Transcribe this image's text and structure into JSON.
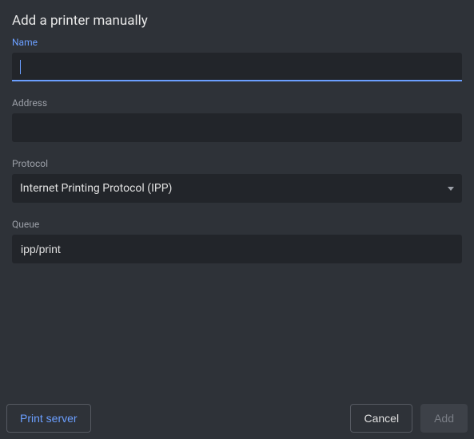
{
  "dialog": {
    "title": "Add a printer manually"
  },
  "fields": {
    "name": {
      "label": "Name",
      "value": ""
    },
    "address": {
      "label": "Address",
      "value": ""
    },
    "protocol": {
      "label": "Protocol",
      "selected": "Internet Printing Protocol (IPP)"
    },
    "queue": {
      "label": "Queue",
      "value": "ipp/print"
    }
  },
  "buttons": {
    "print_server": "Print server",
    "cancel": "Cancel",
    "add": "Add"
  }
}
